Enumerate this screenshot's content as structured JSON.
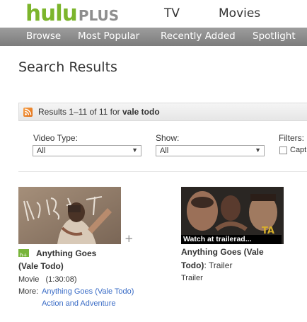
{
  "header": {
    "logo_hulu": "hulu",
    "logo_plus": "PLUS",
    "nav_tv": "TV",
    "nav_movies": "Movies"
  },
  "subnav": {
    "items": [
      "Browse",
      "Most Popular",
      "Recently Added",
      "Spotlight"
    ]
  },
  "page": {
    "title": "Search Results"
  },
  "results_bar": {
    "count_text": "Results 1–11 of 11 for ",
    "query": "vale todo",
    "icon": "rss-icon"
  },
  "filters": {
    "video_type_label": "Video Type:",
    "video_type_value": "All",
    "show_label": "Show:",
    "show_value": "All",
    "filters_label": "Filters:",
    "checkbox_label": "Capt"
  },
  "results": [
    {
      "title_line1": "Anything Goes",
      "title_line2": "(Vale Todo)",
      "type": "Movie",
      "duration": "(1:30:08)",
      "more_label": "More:",
      "more_link1": "Anything Goes (Vale Todo)",
      "more_link2": "Action and Adventure",
      "badge": "hulu-plus-badge-icon",
      "add_symbol": "+"
    },
    {
      "title_line1": "Anything Goes (Vale",
      "title_line2_bold": "Todo)",
      "title_line2_rest": ": Trailer",
      "type": "Trailer",
      "caption": "Watch at trailerad..."
    }
  ],
  "colors": {
    "brand_green": "#7cb52c",
    "nav_grey": "#8a8a8a",
    "link_blue": "#3a6cc6",
    "rss_orange": "#f08a24"
  }
}
